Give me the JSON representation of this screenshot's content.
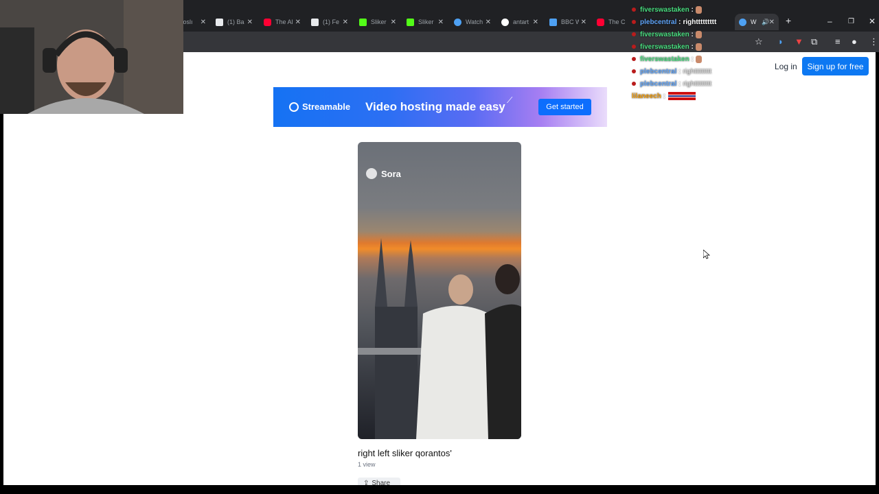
{
  "browser": {
    "tabs": [
      {
        "title": "woslı",
        "color": "#e8a15a"
      },
      {
        "title": "(1) Ba",
        "color": "#e8eaed"
      },
      {
        "title": "The Al",
        "color": "#ff0033"
      },
      {
        "title": "(1) Fe",
        "color": "#e8eaed"
      },
      {
        "title": "Sliker",
        "color": "#53fc18"
      },
      {
        "title": "Sliker",
        "color": "#53fc18"
      },
      {
        "title": "Watch",
        "color": "#4ea1f3"
      },
      {
        "title": "antart",
        "color": "#ffffff"
      },
      {
        "title": "BBC W",
        "color": "#4ea1f3"
      },
      {
        "title": "The C",
        "color": "#ff0033"
      },
      {
        "title": "W",
        "color": "#4ea1f3"
      }
    ],
    "new_tab_label": "+",
    "minimize_label": "–",
    "restore_label": "❐",
    "close_label": "✕",
    "tab_close_label": "✕"
  },
  "header": {
    "login_label": "Log in",
    "signup_label": "Sign up for free"
  },
  "banner": {
    "logo_text": "Streamable",
    "tagline": "Video hosting made easy",
    "cta_label": "Get started"
  },
  "video": {
    "watermark": "Sora",
    "title": "right left sliker qorantos'",
    "views": "1 view",
    "share_label": "Share"
  },
  "chat": [
    {
      "user": "fiverswastaken",
      "color": "#4ade80",
      "message": ""
    },
    {
      "user": "plebcentral",
      "color": "#60a5fa",
      "message": "righttttttttt"
    },
    {
      "user": "fiverswastaken",
      "color": "#4ade80",
      "message": ""
    },
    {
      "user": "fiverswastaken",
      "color": "#4ade80",
      "message": ""
    },
    {
      "user": "fiverswastaken",
      "color": "#4ade80",
      "message": ""
    },
    {
      "user": "plebcentral",
      "color": "#60a5fa",
      "message": "righttttttttt"
    },
    {
      "user": "plebcentral",
      "color": "#60a5fa",
      "message": "righttttttttt"
    },
    {
      "user": "lilaneech",
      "color": "#f59e0b",
      "message": ""
    }
  ]
}
